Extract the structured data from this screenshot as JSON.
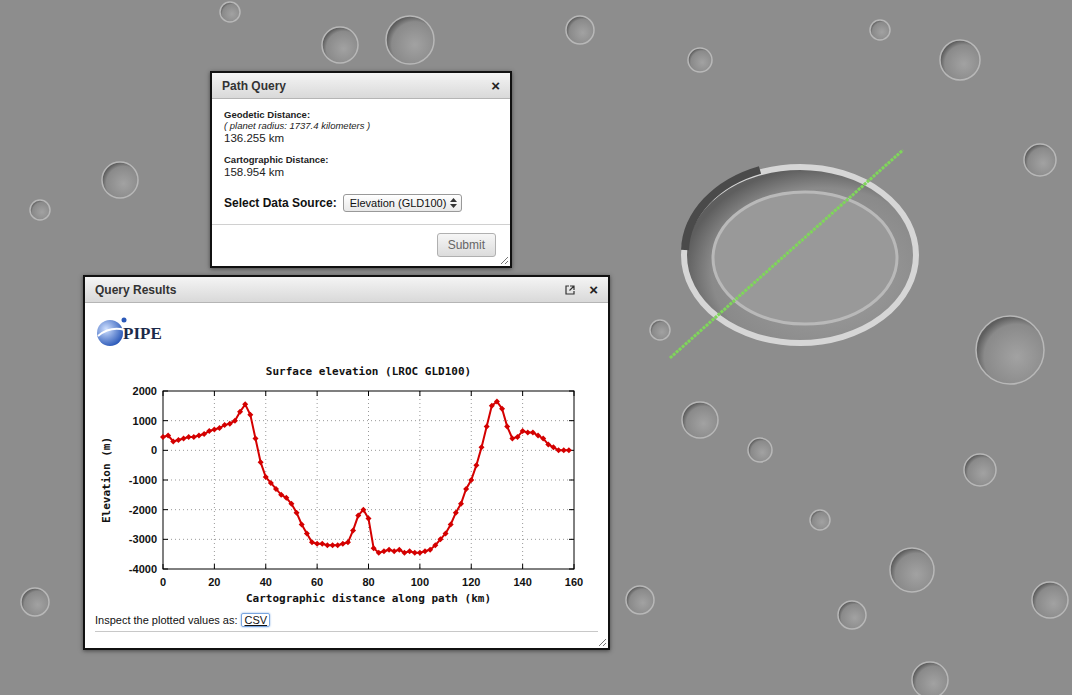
{
  "path_query": {
    "title": "Path Query",
    "close": "×",
    "geodetic_label": "Geodetic Distance:",
    "planet_radius": "( planet radius: 1737.4 kilometers )",
    "geodetic_value": "136.255 km",
    "cartographic_label": "Cartographic Distance:",
    "cartographic_value": "158.954 km",
    "source_label": "Select Data Source:",
    "source_value": "Elevation (GLD100)",
    "submit": "Submit"
  },
  "query_results": {
    "title": "Query Results",
    "close": "×",
    "logo": "PIPE",
    "chart": {
      "title": "Surface elevation (LROC GLD100)",
      "y_label": "Elevation (m)",
      "x_label": "Cartographic distance along path (km)",
      "y_ticks": [
        "2000",
        "1000",
        "0",
        "-1000",
        "-2000",
        "-3000",
        "-4000"
      ],
      "x_ticks": [
        "0",
        "20",
        "40",
        "60",
        "80",
        "100",
        "120",
        "140",
        "160"
      ],
      "series": [
        {
          "name": "elevation",
          "x": [
            0,
            2,
            4,
            6,
            8,
            10,
            12,
            14,
            16,
            18,
            20,
            22,
            24,
            26,
            28,
            30,
            32,
            34,
            36,
            38,
            40,
            42,
            44,
            46,
            48,
            50,
            52,
            54,
            56,
            58,
            60,
            62,
            64,
            66,
            68,
            70,
            72,
            74,
            76,
            78,
            80,
            82,
            84,
            86,
            88,
            90,
            92,
            94,
            96,
            98,
            100,
            102,
            104,
            106,
            108,
            110,
            112,
            114,
            116,
            118,
            120,
            122,
            124,
            126,
            128,
            130,
            132,
            134,
            136,
            138,
            140,
            142,
            144,
            146,
            148,
            150,
            152,
            154,
            156,
            158
          ],
          "values": [
            450,
            500,
            300,
            350,
            400,
            450,
            450,
            500,
            550,
            650,
            700,
            750,
            850,
            900,
            1000,
            1300,
            1550,
            1200,
            400,
            -400,
            -900,
            -1100,
            -1300,
            -1500,
            -1600,
            -1800,
            -2100,
            -2500,
            -2800,
            -3100,
            -3150,
            -3150,
            -3200,
            -3200,
            -3200,
            -3150,
            -3100,
            -2700,
            -2200,
            -2000,
            -2300,
            -3300,
            -3450,
            -3400,
            -3350,
            -3400,
            -3350,
            -3450,
            -3400,
            -3450,
            -3450,
            -3400,
            -3350,
            -3200,
            -3000,
            -2800,
            -2500,
            -2100,
            -1800,
            -1300,
            -1000,
            -500,
            100,
            800,
            1500,
            1650,
            1400,
            800,
            400,
            450,
            650,
            600,
            600,
            500,
            400,
            200,
            100,
            0,
            0,
            0
          ]
        }
      ]
    },
    "footer_label": "Inspect the plotted values as:",
    "csv_link": {
      "label": "CSV",
      "focused": true
    }
  }
}
